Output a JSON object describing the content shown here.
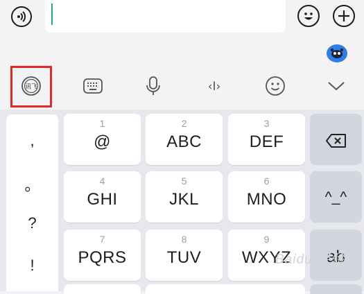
{
  "chat": {
    "voice_icon": "voice-wave-icon",
    "emoji_icon": "emoji-face-icon",
    "add_icon": "plus-icon",
    "input_value": ""
  },
  "toolbar": {
    "items": [
      {
        "icon": "handwriting-mode-icon",
        "selected": true
      },
      {
        "icon": "keyboard-icon"
      },
      {
        "icon": "microphone-icon"
      },
      {
        "icon": "text-cursor-icon"
      },
      {
        "icon": "emoji-icon"
      },
      {
        "icon": "chevron-down-icon"
      }
    ],
    "handwriting_glyph": "讯飞",
    "cursor_glyph": "‹I›"
  },
  "keyboard": {
    "punctuation": [
      ",",
      "。",
      "?",
      "!"
    ],
    "keys": [
      {
        "num": "1",
        "label": "@"
      },
      {
        "num": "2",
        "label": "ABC"
      },
      {
        "num": "3",
        "label": "DEF"
      },
      {
        "num": "4",
        "label": "GHI"
      },
      {
        "num": "5",
        "label": "JKL"
      },
      {
        "num": "6",
        "label": "MNO"
      },
      {
        "num": "7",
        "label": "PQRS"
      },
      {
        "num": "8",
        "label": "TUV"
      },
      {
        "num": "9",
        "label": "WXYZ"
      }
    ],
    "backspace_icon": "backspace-icon",
    "face_key": "^_^",
    "case_key": "ab"
  },
  "watermark": "Baidu 经验",
  "colors": {
    "accent_caret": "#17b26d",
    "highlight_border": "#e3262b",
    "assistant_bubble": "#2f7ee8"
  }
}
